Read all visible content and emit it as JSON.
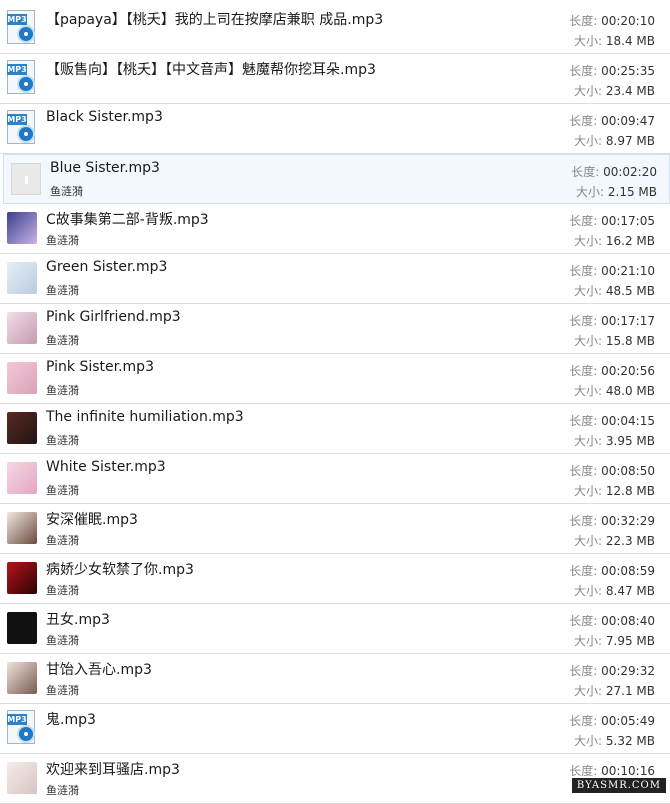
{
  "labels": {
    "duration": "长度:",
    "size": "大小:"
  },
  "rows": [
    {
      "title": "【papaya】【桃夭】我的上司在按摩店兼职 成品.mp3",
      "artist": "",
      "duration": "00:20:10",
      "size": "18.4 MB",
      "icon": "mp3-file-icon"
    },
    {
      "title": "【贩售向】【桃夭】【中文音声】魅魔帮你挖耳朵.mp3",
      "artist": "",
      "duration": "00:25:35",
      "size": "23.4 MB",
      "icon": "mp3-file-icon"
    },
    {
      "title": "Black Sister.mp3",
      "artist": "",
      "duration": "00:09:47",
      "size": "8.97 MB",
      "icon": "mp3-file-icon"
    },
    {
      "title": "Blue Sister.mp3",
      "artist": "鱼涟漪",
      "duration": "00:02:20",
      "size": "2.15 MB",
      "icon": "placeholder-cover-icon",
      "selected": true
    },
    {
      "title": "C故事集第二部-背叛.mp3",
      "artist": "鱼涟漪",
      "duration": "00:17:05",
      "size": "16.2 MB",
      "icon": "album-art",
      "art": [
        "#3b3f8c",
        "#c9b3e8"
      ]
    },
    {
      "title": "Green Sister.mp3",
      "artist": "鱼涟漪",
      "duration": "00:21:10",
      "size": "48.5 MB",
      "icon": "album-art",
      "art": [
        "#e7eef5",
        "#b9cbe0"
      ]
    },
    {
      "title": "Pink Girlfriend.mp3",
      "artist": "鱼涟漪",
      "duration": "00:17:17",
      "size": "15.8 MB",
      "icon": "album-art",
      "art": [
        "#f1dde6",
        "#c59ab2"
      ]
    },
    {
      "title": "Pink Sister.mp3",
      "artist": "鱼涟漪",
      "duration": "00:20:56",
      "size": "48.0 MB",
      "icon": "album-art",
      "art": [
        "#f3c9d8",
        "#d9a1b8"
      ]
    },
    {
      "title": "The infinite humiliation.mp3",
      "artist": "鱼涟漪",
      "duration": "00:04:15",
      "size": "3.95 MB",
      "icon": "album-art",
      "art": [
        "#5a2a22",
        "#1f1414"
      ]
    },
    {
      "title": "White Sister.mp3",
      "artist": "鱼涟漪",
      "duration": "00:08:50",
      "size": "12.8 MB",
      "icon": "album-art",
      "art": [
        "#f6d6e4",
        "#e3a7c1"
      ]
    },
    {
      "title": "安深催眠.mp3",
      "artist": "鱼涟漪",
      "duration": "00:32:29",
      "size": "22.3 MB",
      "icon": "album-art",
      "art": [
        "#f3e7e1",
        "#6b4a3e"
      ]
    },
    {
      "title": "病娇少女软禁了你.mp3",
      "artist": "鱼涟漪",
      "duration": "00:08:59",
      "size": "8.47 MB",
      "icon": "album-art",
      "art": [
        "#b8141b",
        "#2a0505"
      ]
    },
    {
      "title": "丑女.mp3",
      "artist": "鱼涟漪",
      "duration": "00:08:40",
      "size": "7.95 MB",
      "icon": "album-art",
      "art": [
        "#111111",
        "#111111"
      ]
    },
    {
      "title": "甘饴入吾心.mp3",
      "artist": "鱼涟漪",
      "duration": "00:29:32",
      "size": "27.1 MB",
      "icon": "album-art",
      "art": [
        "#efe4dc",
        "#7a5a52"
      ]
    },
    {
      "title": "鬼.mp3",
      "artist": "",
      "duration": "00:05:49",
      "size": "5.32 MB",
      "icon": "mp3-file-icon"
    },
    {
      "title": "欢迎来到耳骚店.mp3",
      "artist": "鱼涟漪",
      "duration": "00:10:16",
      "size": "",
      "icon": "album-art",
      "art": [
        "#f4ecea",
        "#d8c4c0"
      ]
    }
  ],
  "watermark": "BYASMR.COM"
}
